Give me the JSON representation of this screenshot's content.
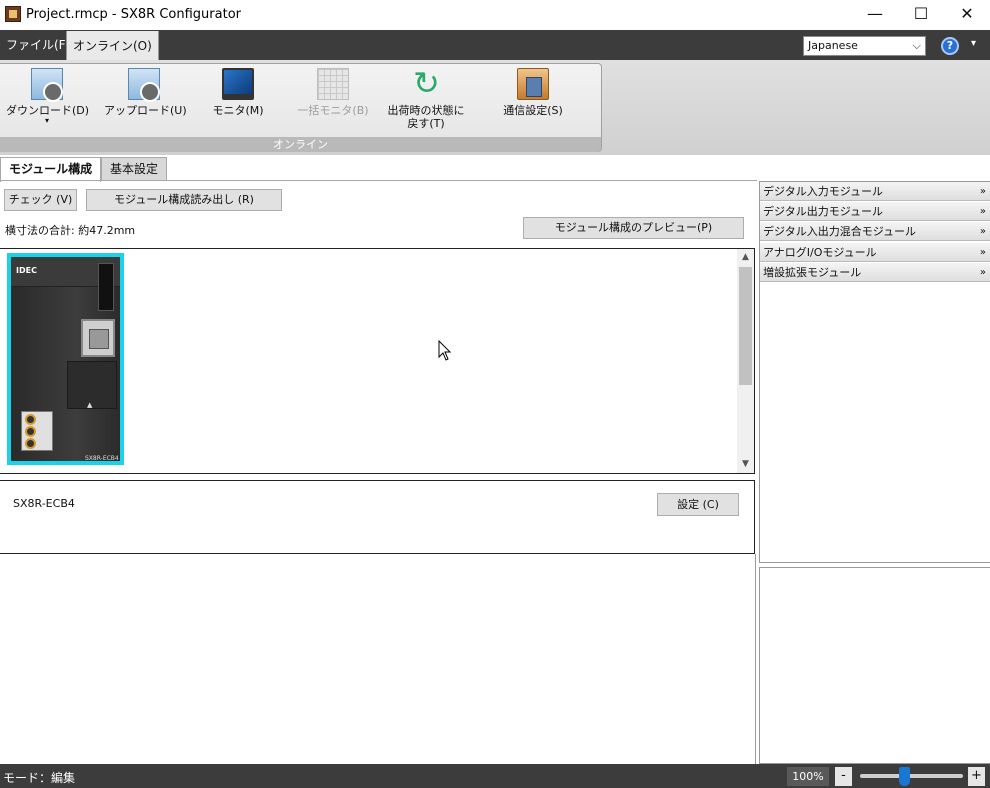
{
  "window": {
    "title": "Project.rmcp - SX8R Configurator",
    "minimize_glyph": "—",
    "maximize_glyph": "☐",
    "close_glyph": "✕"
  },
  "menu": {
    "file": "ファイル(F)",
    "online": "オンライン(O)"
  },
  "language": {
    "selected": "Japanese",
    "chevron": "⌵"
  },
  "help": {
    "glyph": "?",
    "dropdown_glyph": "▾"
  },
  "ribbon": {
    "group_label": "オンライン",
    "buttons": [
      {
        "label": "ダウンロード(D)",
        "icon": "download-icon"
      },
      {
        "label": "アップロード(U)",
        "icon": "upload-icon"
      },
      {
        "label": "モニタ(M)",
        "icon": "monitor-icon"
      },
      {
        "label": "一括モニタ(B)",
        "icon": "batch-monitor-icon",
        "disabled": true
      },
      {
        "label": "出荷時の状態に",
        "label2": "戻す(T)",
        "icon": "factory-reset-icon"
      },
      {
        "label": "通信設定(S)",
        "icon": "communication-settings-icon"
      }
    ],
    "download_dropdown": "▾"
  },
  "tabs": {
    "module_config": "モジュール構成",
    "basic_settings": "基本設定"
  },
  "toolbar": {
    "check": "チェック (V)",
    "read_config": "モジュール構成読み出し (R)",
    "preview": "モジュール構成のプレビュー(P)",
    "total_width": "横寸法の合計: 約47.2mm"
  },
  "module": {
    "brand": "IDEC",
    "name": "SX8R-ECB4"
  },
  "detail": {
    "module_name": "SX8R-ECB4",
    "settings_button": "設定 (C)"
  },
  "palette": {
    "chevron": "»",
    "items": [
      "デジタル入力モジュール",
      "デジタル出力モジュール",
      "デジタル入出力混合モジュール",
      "アナログI/Oモジュール",
      "増設拡張モジュール"
    ]
  },
  "status": {
    "mode": "モード：編集",
    "zoom": "100%",
    "zoom_minus": "-",
    "zoom_plus": "+"
  },
  "colors": {
    "selection_highlight": "#1ad3ea",
    "dark_chrome": "#3c3c3c",
    "zoom_thumb": "#1976d2"
  },
  "scrollbar": {
    "up": "▲",
    "down": "▼"
  }
}
